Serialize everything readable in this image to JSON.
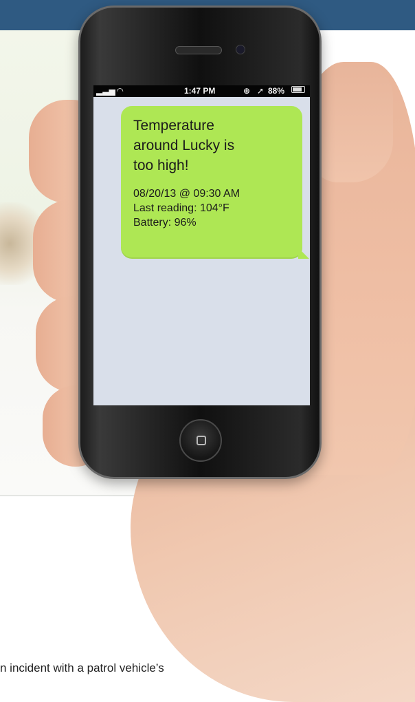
{
  "phone": {
    "status_bar": {
      "signal_icon": "signal-bars-icon",
      "wifi_icon": "wifi-icon",
      "time": "1:47 PM",
      "lock_icon": "rotation-lock-icon",
      "location_icon": "location-arrow-icon",
      "battery": "88%",
      "battery_icon": "battery-icon"
    },
    "message": {
      "title": "Temperature around Lucky is too high!",
      "timestamp": "08/20/13 @ 09:30 AM",
      "reading": "Last reading: 104°F",
      "battery": "Battery: 96%"
    },
    "home_button_icon": "home-square-icon"
  },
  "page": {
    "bottom_text": "n incident with a patrol vehicle’s"
  },
  "colors": {
    "top_band": "#2f5a82",
    "bubble": "#aee754",
    "screen_bg": "#d9dfea"
  }
}
